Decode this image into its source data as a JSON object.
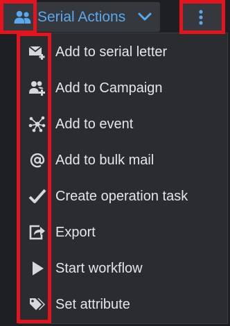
{
  "toolbar": {
    "serial_actions_label": "Serial Actions",
    "user_group_icon": "users-icon",
    "chevron_icon": "chevron-down-icon",
    "more_icon": "kebab-vertical-icon"
  },
  "menu": {
    "items": [
      {
        "label": "Add to serial letter",
        "icon": "envelope-plus-icon"
      },
      {
        "label": "Add to Campaign",
        "icon": "users-plus-icon"
      },
      {
        "label": "Add to event",
        "icon": "network-hub-icon"
      },
      {
        "label": "Add to bulk mail",
        "icon": "at-sign-icon"
      },
      {
        "label": "Create operation task",
        "icon": "checkmark-icon"
      },
      {
        "label": "Export",
        "icon": "export-arrow-icon"
      },
      {
        "label": "Start workflow",
        "icon": "play-icon"
      },
      {
        "label": "Set attribute",
        "icon": "tags-icon"
      }
    ]
  },
  "colors": {
    "accent": "#5aa9ee",
    "highlight": "#e3141d",
    "menu_bg": "#2a2c30",
    "text": "#e4e6ea",
    "icon": "#d6d8dc"
  }
}
